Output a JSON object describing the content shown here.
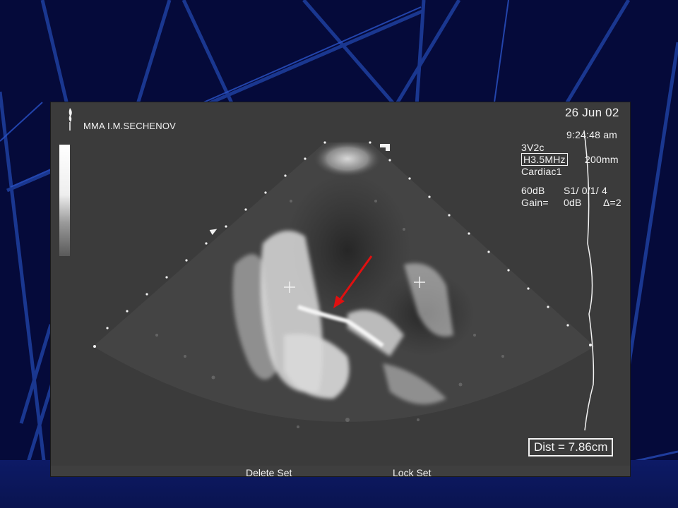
{
  "header": {
    "clinic": "MMA I.M.SECHENOV",
    "date": "26 Jun 02",
    "time": "9:24:48 am"
  },
  "parameters": {
    "probe": "3V2c",
    "frequency": "H3.5MHz",
    "depth": "200mm",
    "preset": "Cardiac1",
    "power": "60dB",
    "setting": "S1/  0/1/ 4",
    "gain_label": "Gain=",
    "gain_value": "0dB",
    "delta": "Δ=2"
  },
  "measurement": {
    "distance": "Dist = 7.86cm"
  },
  "softkeys": {
    "delete_set": "Delete Set",
    "lock_set": "Lock Set"
  },
  "colors": {
    "background": "#050a3a",
    "annotation_arrow": "#e01010",
    "overlay_text": "#f2f2f2"
  }
}
